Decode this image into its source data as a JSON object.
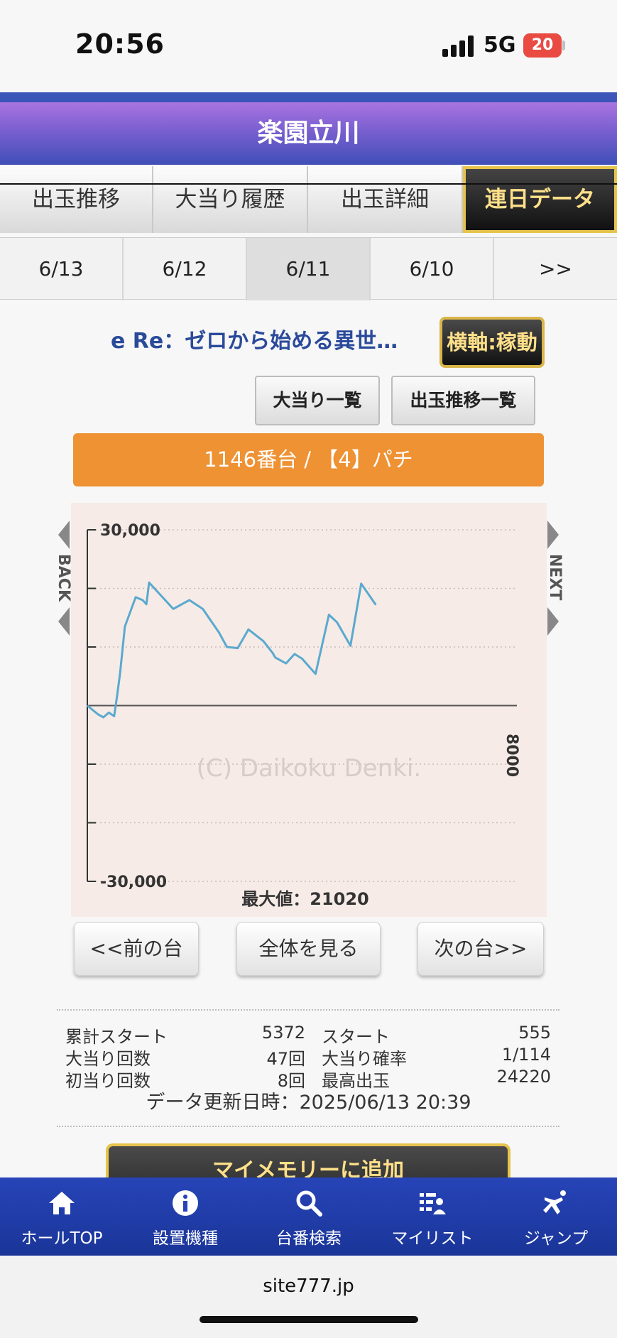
{
  "status": {
    "time": "20:56",
    "network": "5G",
    "battery": "20"
  },
  "header": {
    "title": "楽園立川"
  },
  "tabs": [
    {
      "label": "出玉推移"
    },
    {
      "label": "大当り履歴"
    },
    {
      "label": "出玉詳細"
    },
    {
      "label": "連日データ",
      "active": true
    }
  ],
  "dates": [
    "6/13",
    "6/12",
    "6/11",
    "6/10",
    ">>"
  ],
  "selected_date": "6/11",
  "machine": {
    "name": "e Re：ゼロから始める異世…",
    "axis_button": "横軸:稼動",
    "jackpot_list_button": "大当り一覧",
    "payout_list_button": "出玉推移一覧",
    "banner": "1146番台 / 【4】パチ"
  },
  "chart": {
    "back_label": "BACK",
    "next_label": "NEXT",
    "watermark": "(C) Daikoku Denki.",
    "x_end_label": "8000",
    "max_label": "最大値：21020"
  },
  "chart_data": {
    "type": "line",
    "series": [
      {
        "x": [
          0,
          200,
          300,
          400,
          500,
          560,
          610,
          700,
          900,
          1030,
          1100,
          1150,
          1300,
          1600,
          1900,
          2150,
          2300,
          2450,
          2600,
          2800,
          3000,
          3280,
          3450,
          3500,
          3700,
          3860,
          4000,
          4250,
          4500,
          4650,
          4900,
          5100,
          5372
        ],
        "y": [
          0,
          -1500,
          -2000,
          -1200,
          -1800,
          2000,
          5500,
          13500,
          18500,
          18000,
          17300,
          21000,
          19500,
          16500,
          18000,
          16500,
          14500,
          12500,
          10000,
          9800,
          13000,
          11000,
          9000,
          8200,
          7200,
          8800,
          8000,
          5400,
          15500,
          14200,
          10200,
          20800,
          17200
        ]
      }
    ],
    "xlim": [
      0,
      8000
    ],
    "ylim": [
      -30000,
      30000
    ],
    "yticks": [
      -30000,
      -20000,
      -10000,
      0,
      10000,
      20000,
      30000
    ],
    "ytick_labels": [
      "-30,000",
      "",
      "",
      "",
      "",
      "",
      "30,000"
    ],
    "x_end_label": "8000",
    "max_label": "最大値：21020",
    "grid": true,
    "line_color": "#5aa9cf"
  },
  "nav_buttons": {
    "prev": "<<前の台",
    "all": "全体を見る",
    "next": "次の台>>"
  },
  "stats": {
    "total_start_label": "累計スタート",
    "total_start_value": "5372",
    "start_label": "スタート",
    "start_value": "555",
    "jackpot_count_label": "大当り回数",
    "jackpot_count_value": "47回",
    "jackpot_prob_label": "大当り確率",
    "jackpot_prob_value": "1/114",
    "first_hit_label": "初当り回数",
    "first_hit_value": "8回",
    "max_payout_label": "最高出玉",
    "max_payout_value": "24220",
    "updated": "データ更新日時：2025/06/13 20:39"
  },
  "memory_button": "マイメモリーに追加",
  "bottom_nav": [
    {
      "label": "ホールTOP",
      "icon": "home-icon"
    },
    {
      "label": "設置機種",
      "icon": "info-icon"
    },
    {
      "label": "台番検索",
      "icon": "search-icon"
    },
    {
      "label": "マイリスト",
      "icon": "mylist-icon"
    },
    {
      "label": "ジャンプ",
      "icon": "jump-icon"
    }
  ],
  "browser": {
    "url": "site777.jp"
  },
  "colors": {
    "header_purple": "#a974e0",
    "header_blue": "#3f4fb8",
    "accent_gold": "#e6c34c",
    "banner_orange": "#ee9234",
    "nav_blue": "#2744b8"
  }
}
